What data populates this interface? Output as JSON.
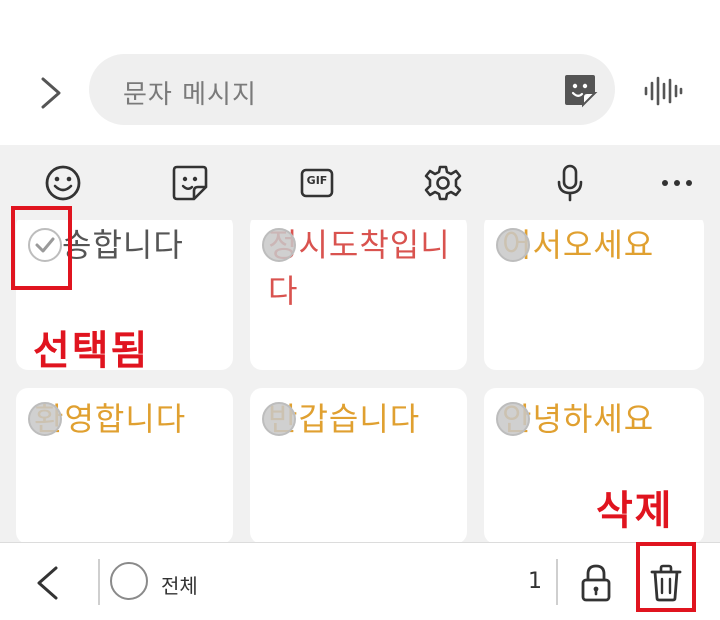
{
  "compose": {
    "placeholder": "문자 메시지",
    "expand_icon": "chevron-right-icon",
    "sticker_icon": "sticker-icon",
    "voice_icon": "voice-wave-icon"
  },
  "toolbar": {
    "items": [
      {
        "icon": "emoji-icon"
      },
      {
        "icon": "sticker-icon"
      },
      {
        "icon": "gif-icon",
        "label": "GIF"
      },
      {
        "icon": "gear-icon"
      },
      {
        "icon": "microphone-icon"
      },
      {
        "icon": "more-icon"
      }
    ]
  },
  "phrases": [
    {
      "text": "배송합니다",
      "display": "송합니다",
      "color": "#555555",
      "selected": true
    },
    {
      "text": "정시도착입니다",
      "display": "정시도착입니다",
      "color": "#d9534f",
      "selected": false
    },
    {
      "text": "어서오세요",
      "display": "어서오세요",
      "color": "#e0a030",
      "selected": false
    },
    {
      "text": "환영합니다",
      "display": "환영합니다",
      "color": "#e0a030",
      "selected": false
    },
    {
      "text": "반갑습니다",
      "display": "반갑습니다",
      "color": "#e0a030",
      "selected": false
    },
    {
      "text": "안녕하세요",
      "display": "안녕하세요",
      "color": "#e0a030",
      "selected": false
    }
  ],
  "annotations": {
    "selected_label": "선택됨",
    "delete_label": "삭제",
    "highlight_color": "#e0141f"
  },
  "bottom_bar": {
    "select_all_label": "전체",
    "selected_count": "1",
    "lock_icon": "lock-icon",
    "trash_icon": "trash-icon",
    "back_icon": "chevron-left-icon"
  }
}
